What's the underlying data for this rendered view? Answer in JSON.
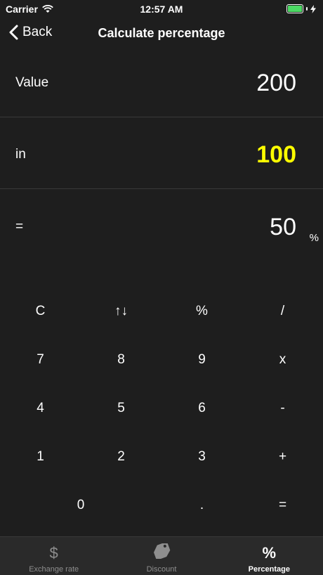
{
  "status": {
    "carrier": "Carrier",
    "time": "12:57 AM"
  },
  "nav": {
    "back_label": "Back",
    "title": "Calculate percentage"
  },
  "rows": {
    "value_label": "Value",
    "value": "200",
    "in_label": "in",
    "in_value": "100",
    "result_label": "=",
    "result_value": "50",
    "result_unit": "%"
  },
  "colors": {
    "background": "#1e1e1e",
    "highlight": "#ffff00",
    "tab_inactive": "#8e8e8e"
  },
  "keypad": [
    [
      "C",
      "↑↓",
      "%",
      "/"
    ],
    [
      "7",
      "8",
      "9",
      "x"
    ],
    [
      "4",
      "5",
      "6",
      "-"
    ],
    [
      "1",
      "2",
      "3",
      "+"
    ],
    [
      "0",
      ".",
      "="
    ]
  ],
  "tabs": [
    {
      "label": "Exchange rate",
      "icon": "dollar-icon"
    },
    {
      "label": "Discount",
      "icon": "sale-tag-icon"
    },
    {
      "label": "Percentage",
      "icon": "percent-icon"
    }
  ]
}
